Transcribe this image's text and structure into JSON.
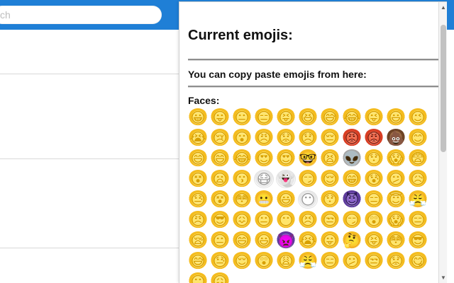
{
  "search": {
    "placeholder": "ch"
  },
  "popup": {
    "title": "Current emojis:",
    "instructions": "You can copy paste emojis from here:",
    "faces_label": "Faces:",
    "emojis": [
      "😀",
      "😛",
      "😐",
      "😑",
      "😝",
      "😆",
      "😅",
      "😂",
      "😜",
      "😃",
      "😉",
      "😭",
      "😢",
      "😮",
      "😠",
      "😟",
      "😞",
      "😔",
      "😡",
      "😡",
      "💩",
      "😊",
      "😄",
      "😄",
      "😂",
      "😍",
      "😍",
      "🤓",
      "😫",
      "👽",
      "😯",
      "😱",
      "😨",
      "😵",
      "😦",
      "😗",
      "😷",
      "👻",
      "😏",
      "😌",
      "😁",
      "😰",
      "😕",
      "😥",
      "😓",
      "😵",
      "😳",
      "😬",
      "😃",
      "😶",
      "😯",
      "😈",
      "😑",
      "😇",
      "😤",
      "😠",
      "😎",
      "😖",
      "😐",
      "😶",
      "😣",
      "😒",
      "😏",
      "😲",
      "😱",
      "😑",
      "😪",
      "😐",
      "😄",
      "😃",
      "👿",
      "😭",
      "😛",
      "🤔",
      "😝",
      "😳",
      "😎",
      "😅",
      "😓",
      "😌",
      "😲",
      "😩",
      "😤",
      "😑",
      "😕",
      "😒",
      "😟",
      "😋",
      "😶",
      "😖"
    ]
  },
  "ui": {
    "scroll_up_icon": "triangle-up",
    "scroll_down_icon": "triangle-down"
  }
}
